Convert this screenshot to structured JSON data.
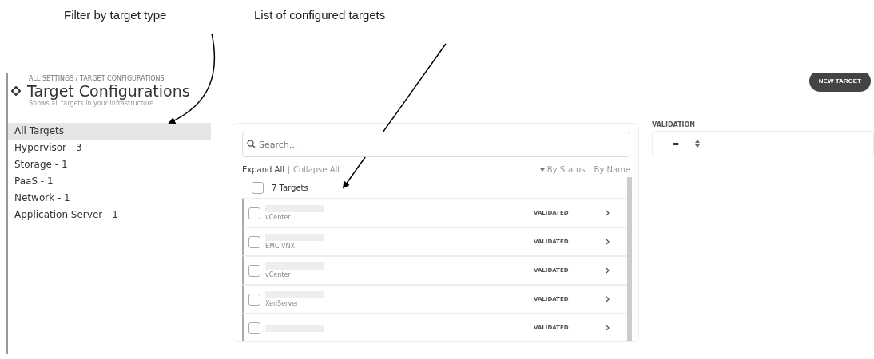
{
  "annotations": [
    {
      "text": "Filter by target type"
    },
    {
      "text": "List of configured targets"
    }
  ],
  "header": {
    "breadcrumb": "ALL SETTINGS / TARGET CONFIGURATIONS",
    "title": "Target Configurations",
    "subtitle": "Shows all targets in your infrastructure",
    "new_button": "NEW TARGET"
  },
  "sidebar": {
    "items": [
      {
        "label": "All Targets",
        "selected": true
      },
      {
        "label": "Hypervisor - 3",
        "selected": false
      },
      {
        "label": "Storage - 1",
        "selected": false
      },
      {
        "label": "PaaS - 1",
        "selected": false
      },
      {
        "label": "Network - 1",
        "selected": false
      },
      {
        "label": "Application Server - 1",
        "selected": false
      }
    ]
  },
  "search": {
    "placeholder": "Search..."
  },
  "toolbar": {
    "expand": "Expand All",
    "collapse": "Collapse All",
    "sort_status": "By Status",
    "sort_name": "By Name"
  },
  "list_header": {
    "label": "7 Targets",
    "checked": false
  },
  "targets": [
    {
      "type": "vCenter",
      "status": "VALIDATED",
      "checked": false
    },
    {
      "type": "EMC VNX",
      "status": "VALIDATED",
      "checked": false
    },
    {
      "type": "vCenter",
      "status": "VALIDATED",
      "checked": false
    },
    {
      "type": "XenServer",
      "status": "VALIDATED",
      "checked": false
    },
    {
      "status": "VALIDATED",
      "checked": false
    }
  ],
  "validation": {
    "label": "VALIDATION",
    "operator": "="
  }
}
